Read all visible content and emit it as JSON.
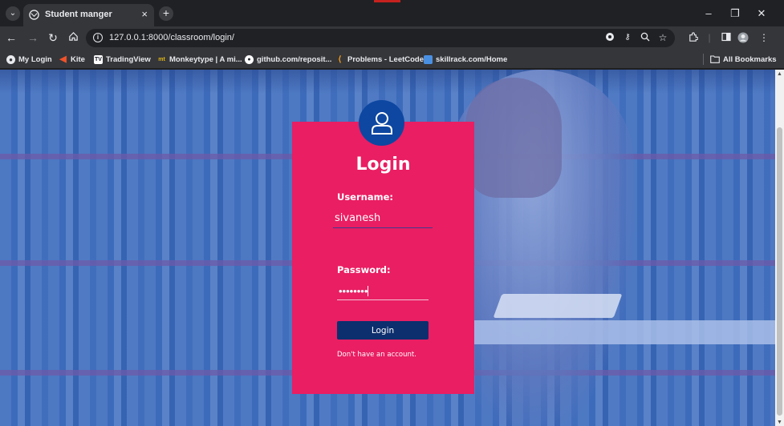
{
  "browser": {
    "tab": {
      "title": "Student manger",
      "close": "×"
    },
    "new_tab": "+",
    "tab_list": "⌄",
    "window": {
      "minimize": "–",
      "restore": "❐",
      "close": "✕"
    },
    "url": "127.0.0.1:8000/classroom/login/",
    "bookmarks": [
      {
        "label": "My Login",
        "icon": "globe-icon",
        "color": "#e8eaed"
      },
      {
        "label": "Kite",
        "icon": "kite-icon",
        "color": "#f0522a"
      },
      {
        "label": "TradingView",
        "icon": "tradingview-icon",
        "color": "#ffffff"
      },
      {
        "label": "Monkeytype | A mi...",
        "icon": "monkeytype-icon",
        "color": "#e2b714"
      },
      {
        "label": "github.com/reposit...",
        "icon": "github-icon",
        "color": "#ffffff"
      },
      {
        "label": "Problems - LeetCode",
        "icon": "leetcode-icon",
        "color": "#ffa116"
      },
      {
        "label": "skillrack.com/Home",
        "icon": "skillrack-icon",
        "color": "#4a90e2"
      }
    ],
    "all_bookmarks": "All Bookmarks"
  },
  "login": {
    "title": "Login",
    "username_label": "Username:",
    "username_value": "sivanesh",
    "password_label": "Password:",
    "password_value": "sivanesh",
    "button": "Login",
    "signup_link": "Don't have an account."
  },
  "colors": {
    "card": "#e91e63",
    "avatar": "#0d47a1",
    "button": "#0d2f6e",
    "overlay": "#3165b8"
  }
}
